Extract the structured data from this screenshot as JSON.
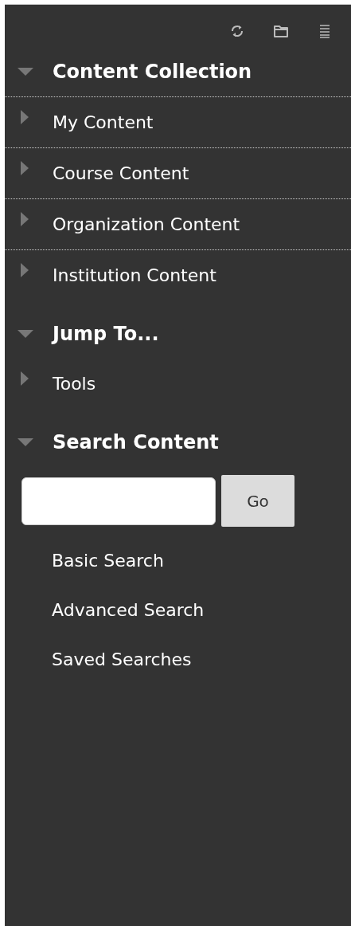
{
  "toolbar": {
    "buttons": [
      {
        "kind": "refresh"
      },
      {
        "kind": "folder"
      },
      {
        "kind": "menu"
      }
    ]
  },
  "sections": [
    {
      "heading": "Content Collection",
      "expanded": true,
      "items": [
        {
          "label": "My Content",
          "expanded": false
        },
        {
          "label": "Course Content",
          "expanded": false
        },
        {
          "label": "Organization Content",
          "expanded": false
        },
        {
          "label": "Institution Content",
          "expanded": false
        }
      ]
    },
    {
      "heading": "Jump To...",
      "expanded": true,
      "items": [
        {
          "label": "Tools",
          "expanded": false
        }
      ]
    },
    {
      "heading": "Search Content",
      "expanded": true,
      "search": {
        "button": "Go"
      },
      "links": [
        "Basic Search",
        "Advanced Search",
        "Saved Searches"
      ]
    }
  ]
}
